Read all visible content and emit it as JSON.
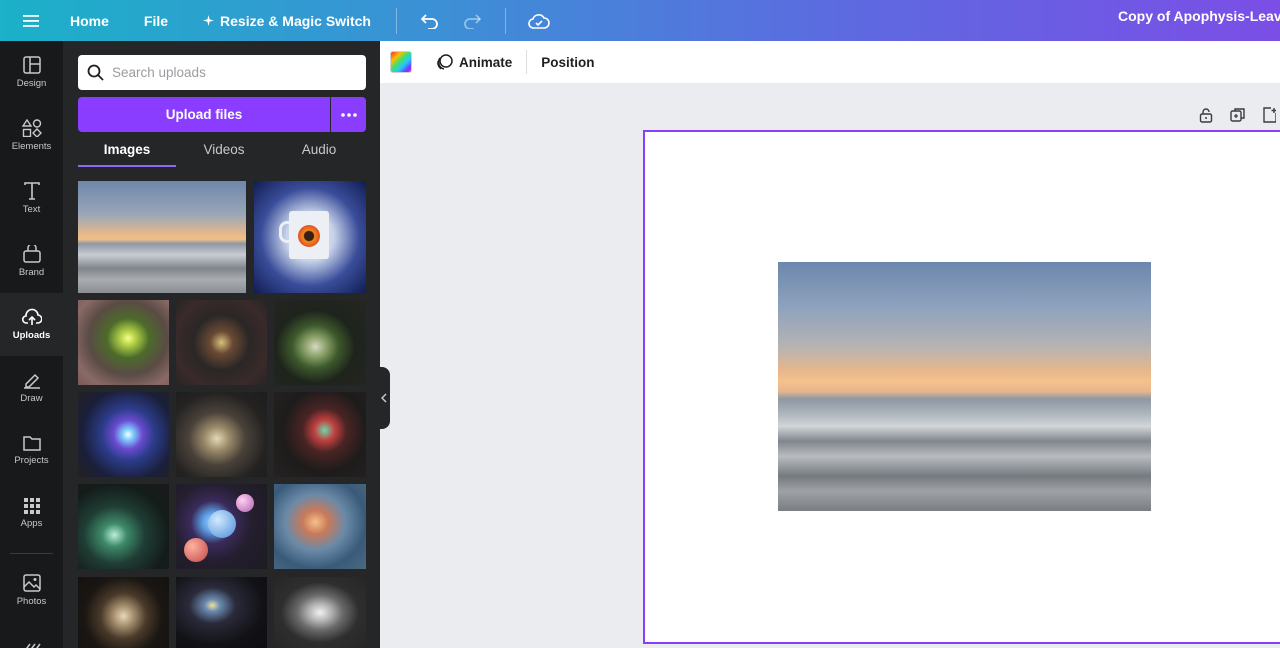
{
  "topbar": {
    "home": "Home",
    "file": "File",
    "resize": "Resize & Magic Switch",
    "doc_title": "Copy of Apophysis-Leaving"
  },
  "rail": [
    {
      "label": "Design",
      "icon": "design-icon"
    },
    {
      "label": "Elements",
      "icon": "elements-icon"
    },
    {
      "label": "Text",
      "icon": "text-icon"
    },
    {
      "label": "Brand",
      "icon": "brand-icon"
    },
    {
      "label": "Uploads",
      "icon": "uploads-icon",
      "active": true
    },
    {
      "label": "Draw",
      "icon": "draw-icon"
    },
    {
      "label": "Projects",
      "icon": "projects-icon"
    },
    {
      "label": "Apps",
      "icon": "apps-icon"
    },
    {
      "label": "Photos",
      "icon": "photos-icon"
    }
  ],
  "uploads": {
    "search_placeholder": "Search uploads",
    "upload_button": "Upload files",
    "tabs": [
      "Images",
      "Videos",
      "Audio"
    ],
    "active_tab": "Images"
  },
  "toolbar": {
    "animate": "Animate",
    "position": "Position"
  },
  "colors": {
    "accent": "#8b3dff",
    "panel_bg": "#252627",
    "rail_bg": "#18191b",
    "canvas_bg": "#ebecf0"
  }
}
